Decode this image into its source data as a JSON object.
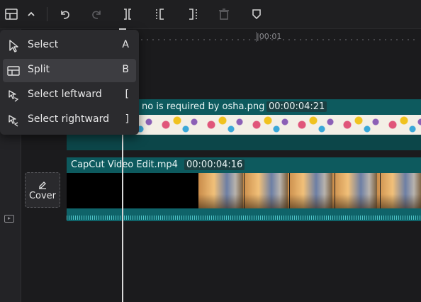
{
  "toolbar": {
    "items": [
      "split-layout",
      "dropdown",
      "undo",
      "redo",
      "split",
      "split-left",
      "split-right",
      "delete",
      "marker"
    ]
  },
  "menu": {
    "items": [
      {
        "label": "Select",
        "shortcut": "A",
        "icon": "pointer-icon"
      },
      {
        "label": "Split",
        "shortcut": "B",
        "icon": "split-icon"
      },
      {
        "label": "Select leftward",
        "shortcut": "[",
        "icon": "select-leftward-icon"
      },
      {
        "label": "Select rightward",
        "shortcut": "]",
        "icon": "select-rightward-icon"
      }
    ],
    "active_index": 1
  },
  "ruler": {
    "timecode": "|00:01"
  },
  "text_clip": {
    "title": "no is required by osha.png",
    "duration": "00:00:04:21"
  },
  "video_clip": {
    "title": "CapCut Video Edit.mp4",
    "duration": "00:00:04:16"
  },
  "cover": {
    "label": "Cover"
  },
  "colors": {
    "accent_teal": "#0d5a5e",
    "background": "#1b1b1d",
    "menu_bg": "#2b2b2e"
  }
}
